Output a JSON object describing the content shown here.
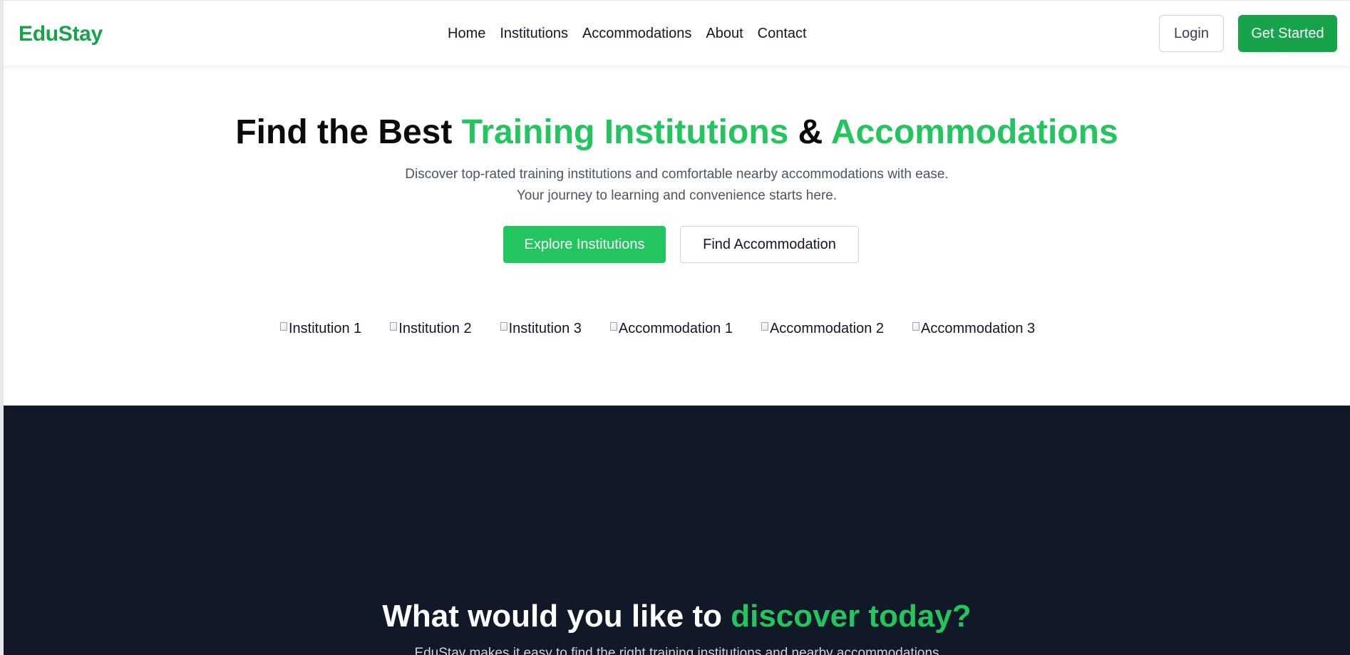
{
  "header": {
    "logo": "EduStay",
    "nav": [
      "Home",
      "Institutions",
      "Accommodations",
      "About",
      "Contact"
    ],
    "login_label": "Login",
    "get_started_label": "Get Started"
  },
  "hero": {
    "title_part1": "Find the Best ",
    "title_accent1": "Training Institutions",
    "title_part2": " & ",
    "title_accent2": "Accommodations",
    "subtitle_line1": "Discover top-rated training institutions and comfortable nearby accommodations with ease.",
    "subtitle_line2": "Your journey to learning and convenience starts here.",
    "explore_label": "Explore Institutions",
    "find_label": "Find Accommodation",
    "images": [
      "Institution 1",
      "Institution 2",
      "Institution 3",
      "Accommodation 1",
      "Accommodation 2",
      "Accommodation 3"
    ]
  },
  "discover": {
    "title_part1": "What would you like to ",
    "title_accent": "discover today?",
    "subtitle": "EduStay makes it easy to find the right training institutions and nearby accommodations"
  },
  "colors": {
    "brand_green": "#16a34a",
    "accent_green": "#22c55e",
    "dark_bg": "#111827"
  }
}
